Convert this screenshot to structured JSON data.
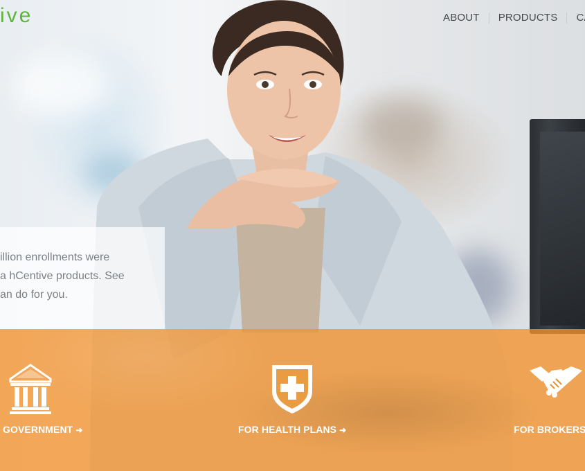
{
  "header": {
    "logo_text": "ive",
    "nav": [
      {
        "label": "ABOUT"
      },
      {
        "label": "PRODUCTS"
      },
      {
        "label": "CAR"
      }
    ]
  },
  "hero": {
    "message_lines": [
      "illion enrollments were",
      "a hCentive products. See",
      "an do for you."
    ]
  },
  "segments": [
    {
      "label": "GOVERNMENT",
      "arrow": "➜",
      "icon": "government-building-icon"
    },
    {
      "label": "FOR HEALTH PLANS",
      "arrow": "➜",
      "icon": "shield-plus-icon"
    },
    {
      "label": "FOR BROKERS",
      "arrow": "",
      "icon": "handshake-icon"
    }
  ],
  "colors": {
    "brand_green": "#5db43a",
    "band_orange": "#f3922d",
    "nav_text": "#45494d",
    "body_text": "#7a7f84"
  }
}
